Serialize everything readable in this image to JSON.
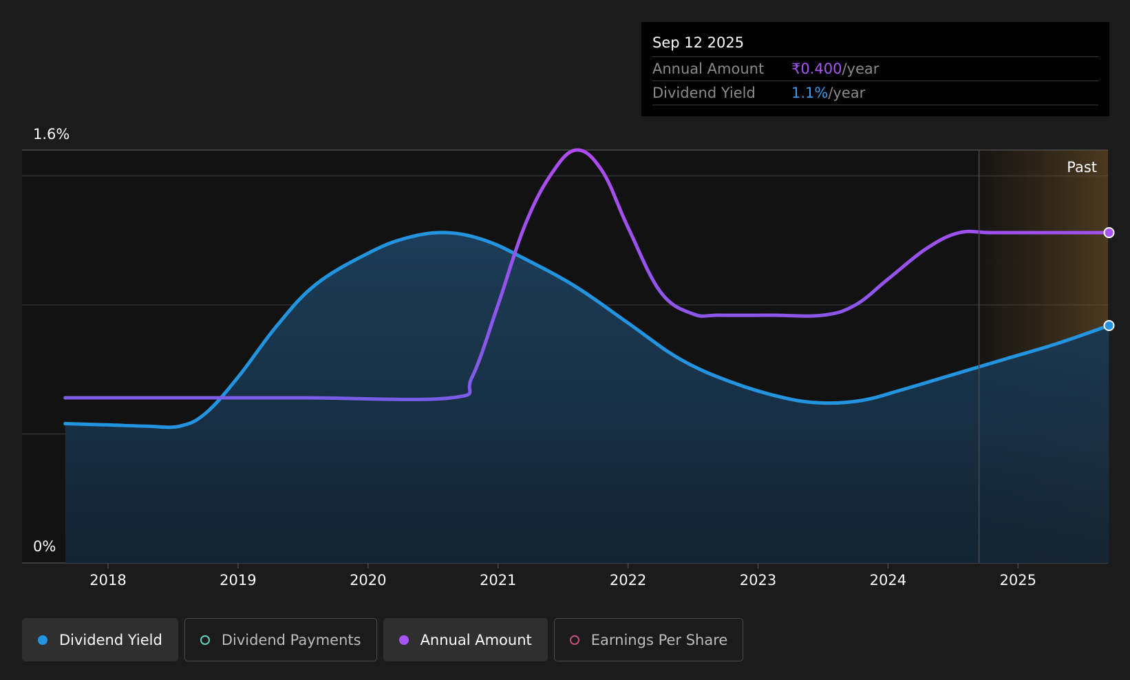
{
  "tooltip": {
    "date": "Sep 12 2025",
    "rows": [
      {
        "label": "Annual Amount",
        "value": "₹0.400",
        "unit": "/year",
        "color": "#a855f7"
      },
      {
        "label": "Dividend Yield",
        "value": "1.1%",
        "unit": "/year",
        "color": "#3b9be6"
      }
    ]
  },
  "legend": [
    {
      "label": "Dividend Yield",
      "color": "#2394df",
      "style": "filled",
      "active": true,
      "name": "legend-dividend-yield"
    },
    {
      "label": "Dividend Payments",
      "color": "#5fcfbf",
      "style": "hollow",
      "active": false,
      "name": "legend-dividend-payments"
    },
    {
      "label": "Annual Amount",
      "color": "#a855f7",
      "style": "filled",
      "active": true,
      "name": "legend-annual-amount"
    },
    {
      "label": "Earnings Per Share",
      "color": "#c0507e",
      "style": "hollow",
      "active": false,
      "name": "legend-earnings-per-share"
    }
  ],
  "chart_data": {
    "type": "line",
    "y_tick_labels": [
      "1.6%",
      "0%"
    ],
    "ylim": [
      0,
      1.6
    ],
    "xlim": [
      2017.67,
      2025.7
    ],
    "x_ticks": [
      2018,
      2019,
      2020,
      2021,
      2022,
      2023,
      2024,
      2025
    ],
    "past_region_start": 2024.7,
    "past_label": "Past",
    "grid": true,
    "series": [
      {
        "name": "Dividend Yield",
        "color": "#2394df",
        "area": true,
        "points": [
          [
            2017.67,
            0.54
          ],
          [
            2018.0,
            0.535
          ],
          [
            2018.3,
            0.53
          ],
          [
            2018.55,
            0.53
          ],
          [
            2018.75,
            0.58
          ],
          [
            2019.0,
            0.72
          ],
          [
            2019.3,
            0.92
          ],
          [
            2019.6,
            1.08
          ],
          [
            2020.0,
            1.2
          ],
          [
            2020.3,
            1.26
          ],
          [
            2020.6,
            1.28
          ],
          [
            2020.9,
            1.25
          ],
          [
            2021.2,
            1.18
          ],
          [
            2021.6,
            1.07
          ],
          [
            2022.0,
            0.93
          ],
          [
            2022.4,
            0.79
          ],
          [
            2022.8,
            0.7
          ],
          [
            2023.2,
            0.64
          ],
          [
            2023.5,
            0.62
          ],
          [
            2023.8,
            0.63
          ],
          [
            2024.1,
            0.67
          ],
          [
            2024.5,
            0.73
          ],
          [
            2024.9,
            0.79
          ],
          [
            2025.3,
            0.85
          ],
          [
            2025.7,
            0.92
          ]
        ]
      },
      {
        "name": "Annual Amount",
        "color": "#a855f7",
        "area": false,
        "points": [
          [
            2017.67,
            0.64
          ],
          [
            2018.5,
            0.64
          ],
          [
            2019.5,
            0.64
          ],
          [
            2020.64,
            0.64
          ],
          [
            2020.8,
            0.72
          ],
          [
            2021.0,
            1.0
          ],
          [
            2021.2,
            1.3
          ],
          [
            2021.4,
            1.5
          ],
          [
            2021.6,
            1.6
          ],
          [
            2021.8,
            1.52
          ],
          [
            2022.0,
            1.3
          ],
          [
            2022.25,
            1.05
          ],
          [
            2022.5,
            0.965
          ],
          [
            2022.7,
            0.96
          ],
          [
            2023.1,
            0.96
          ],
          [
            2023.5,
            0.96
          ],
          [
            2023.75,
            1.0
          ],
          [
            2024.0,
            1.1
          ],
          [
            2024.3,
            1.22
          ],
          [
            2024.55,
            1.28
          ],
          [
            2024.8,
            1.28
          ],
          [
            2025.3,
            1.28
          ],
          [
            2025.7,
            1.28
          ]
        ]
      }
    ]
  }
}
